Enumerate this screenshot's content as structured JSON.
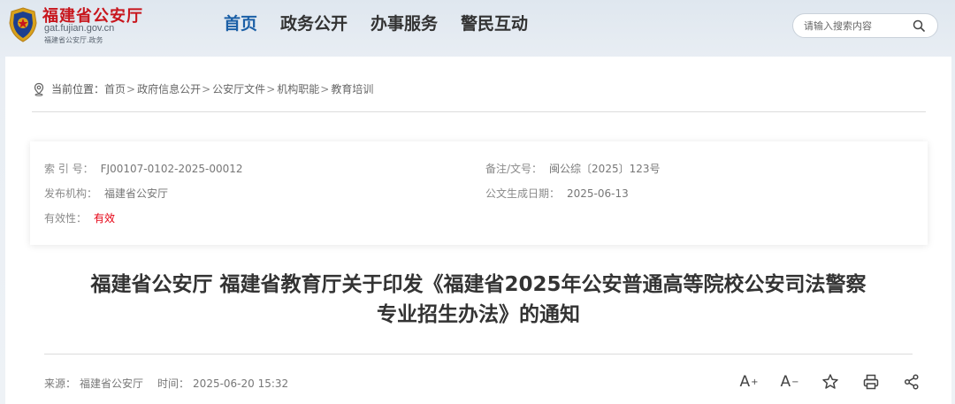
{
  "header": {
    "brand_title": "福建省公安厅",
    "brand_domain": "gat.fujian.gov.cn",
    "brand_sub": "福建省公安厅.政务",
    "logo_icon": "police-emblem-icon"
  },
  "nav": {
    "items": [
      {
        "label": "首页",
        "active": true
      },
      {
        "label": "政务公开",
        "active": false
      },
      {
        "label": "办事服务",
        "active": false
      },
      {
        "label": "警民互动",
        "active": false
      }
    ]
  },
  "search": {
    "placeholder": "请输入搜索内容",
    "icon": "search-icon"
  },
  "breadcrumb": {
    "label": "当前位置：",
    "items": [
      "首页",
      "政府信息公开",
      "公安厅文件",
      "机构职能",
      "教育培训"
    ],
    "separator": ">"
  },
  "meta": {
    "index_label": "索 引 号：",
    "index_value": "FJ00107-0102-2025-00012",
    "docno_label": "备注/文号：",
    "docno_value": "闽公综〔2025〕123号",
    "org_label": "发布机构：",
    "org_value": "福建省公安厅",
    "date_label": "公文生成日期：",
    "date_value": "2025-06-13",
    "valid_label": "有效性：",
    "valid_value": "有效",
    "valid_color": "#e60012"
  },
  "document": {
    "title_line1": "福建省公安厅 福建省教育厅关于印发《福建省2025年公安普通高等院校公安司法警察",
    "title_line2": "专业招生办法》的通知"
  },
  "source_bar": {
    "source_label": "来源：",
    "source_value": "福建省公安厅",
    "time_label": "时间：",
    "time_value": "2025-06-20 15:32"
  },
  "tools": {
    "font_increase": "A",
    "font_increase_sup": "+",
    "font_decrease": "A",
    "font_decrease_sup": "−",
    "icons": [
      "font-increase-icon",
      "font-decrease-icon",
      "star-icon",
      "print-icon",
      "share-icon"
    ]
  },
  "colors": {
    "accent": "#1b5fa6",
    "brand_red": "#c8161d"
  }
}
